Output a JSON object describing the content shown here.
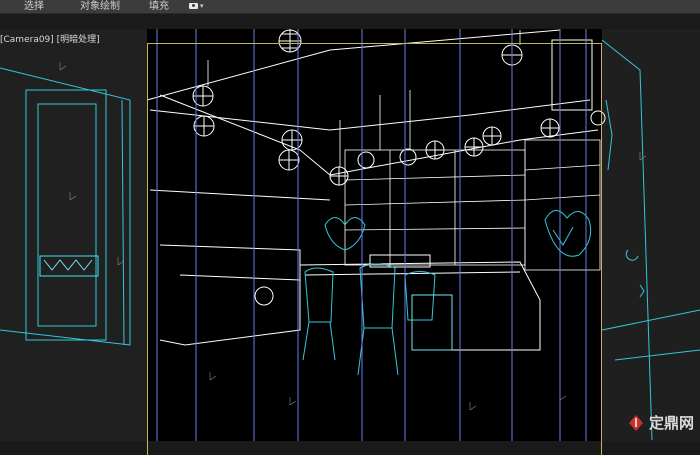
{
  "toolbar": {
    "items": [
      {
        "label": "选择"
      },
      {
        "label": "对象绘制"
      },
      {
        "label": "填充"
      }
    ],
    "display_icon": "camera-icon"
  },
  "viewport": {
    "label": "[Camera09] [明暗处理]",
    "view_mode": "wireframe",
    "safe_frame_color": "#c7b35a",
    "wire_colors": {
      "primary": "#ffffff",
      "accent": "#33c7d9",
      "blue_lines": "#6c7cf0"
    }
  },
  "watermark": {
    "text": "定鼎网",
    "icon": "pen-nib-icon"
  }
}
